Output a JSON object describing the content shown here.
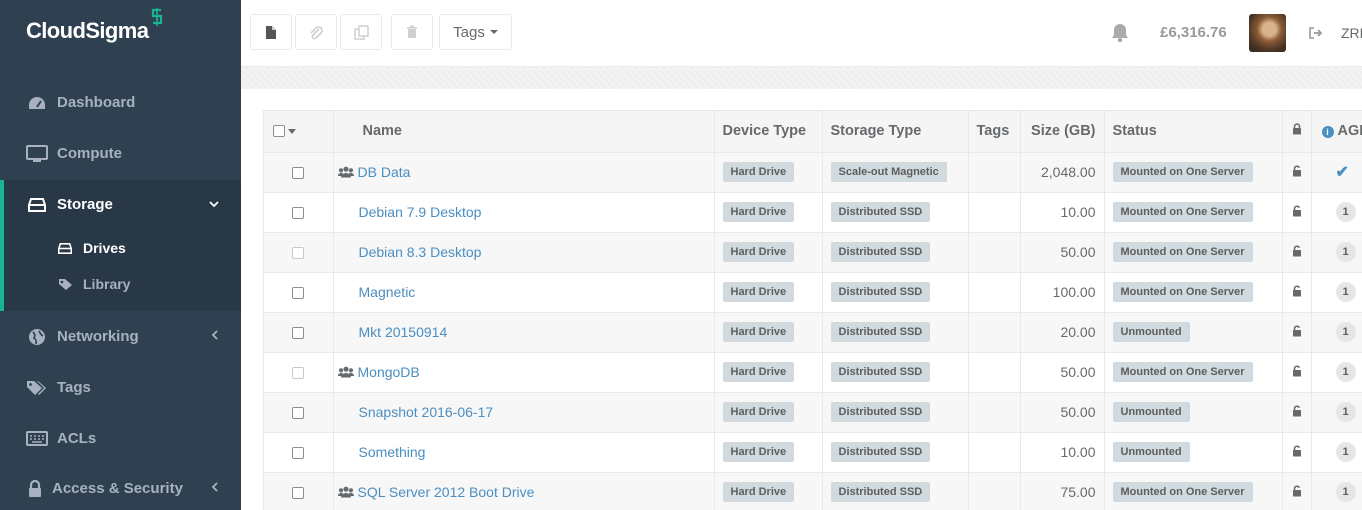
{
  "brand": {
    "name": "CloudSigma",
    "mark_color": "#1ab394"
  },
  "sidebar": {
    "items": [
      {
        "label": "Dashboard",
        "icon": "dashboard-icon"
      },
      {
        "label": "Compute",
        "icon": "monitor-icon"
      },
      {
        "label": "Storage",
        "icon": "drive-icon",
        "active": true,
        "expanded": true
      },
      {
        "label": "Networking",
        "icon": "globe-icon"
      },
      {
        "label": "Tags",
        "icon": "tags-icon"
      },
      {
        "label": "ACLs",
        "icon": "keyboard-icon"
      },
      {
        "label": "Access & Security",
        "icon": "lock-icon"
      }
    ],
    "storage_sub": [
      {
        "label": "Drives",
        "icon": "drive-icon",
        "active": true
      },
      {
        "label": "Library",
        "icon": "tag-icon"
      }
    ]
  },
  "topbar": {
    "tags_label": "Tags",
    "balance": "£6,316.76",
    "region": "ZRH"
  },
  "colors": {
    "accent": "#1ab394",
    "link": "#4a8ec2",
    "sidebar_bg": "#2f4050"
  },
  "table": {
    "columns": [
      "Name",
      "Device Type",
      "Storage Type",
      "Tags",
      "Size (GB)",
      "Status",
      "AGI"
    ],
    "rows": [
      {
        "group": true,
        "checkbox": "enabled",
        "name": "DB Data",
        "device": "Hard Drive",
        "storage": "Scale-out Magnetic",
        "tags": "",
        "size": "2,048.00",
        "status": "Mounted on One Server",
        "agi": "✔"
      },
      {
        "group": false,
        "checkbox": "enabled",
        "name": "Debian 7.9 Desktop",
        "device": "Hard Drive",
        "storage": "Distributed SSD",
        "tags": "",
        "size": "10.00",
        "status": "Mounted on One Server",
        "agi": "1"
      },
      {
        "group": false,
        "checkbox": "disabled",
        "name": "Debian 8.3 Desktop",
        "device": "Hard Drive",
        "storage": "Distributed SSD",
        "tags": "",
        "size": "50.00",
        "status": "Mounted on One Server",
        "agi": "1"
      },
      {
        "group": false,
        "checkbox": "enabled",
        "name": "Magnetic",
        "device": "Hard Drive",
        "storage": "Distributed SSD",
        "tags": "",
        "size": "100.00",
        "status": "Mounted on One Server",
        "agi": "1"
      },
      {
        "group": false,
        "checkbox": "enabled",
        "name": "Mkt 20150914",
        "device": "Hard Drive",
        "storage": "Distributed SSD",
        "tags": "",
        "size": "20.00",
        "status": "Unmounted",
        "agi": "1"
      },
      {
        "group": true,
        "checkbox": "disabled",
        "name": "MongoDB",
        "device": "Hard Drive",
        "storage": "Distributed SSD",
        "tags": "",
        "size": "50.00",
        "status": "Mounted on One Server",
        "agi": "1"
      },
      {
        "group": false,
        "checkbox": "enabled",
        "name": "Snapshot 2016-06-17",
        "device": "Hard Drive",
        "storage": "Distributed SSD",
        "tags": "",
        "size": "50.00",
        "status": "Unmounted",
        "agi": "1"
      },
      {
        "group": false,
        "checkbox": "enabled",
        "name": "Something",
        "device": "Hard Drive",
        "storage": "Distributed SSD",
        "tags": "",
        "size": "10.00",
        "status": "Unmounted",
        "agi": "1"
      },
      {
        "group": true,
        "checkbox": "enabled",
        "name": "SQL Server 2012 Boot Drive",
        "device": "Hard Drive",
        "storage": "Distributed SSD",
        "tags": "",
        "size": "75.00",
        "status": "Mounted on One Server",
        "agi": "1"
      }
    ]
  }
}
